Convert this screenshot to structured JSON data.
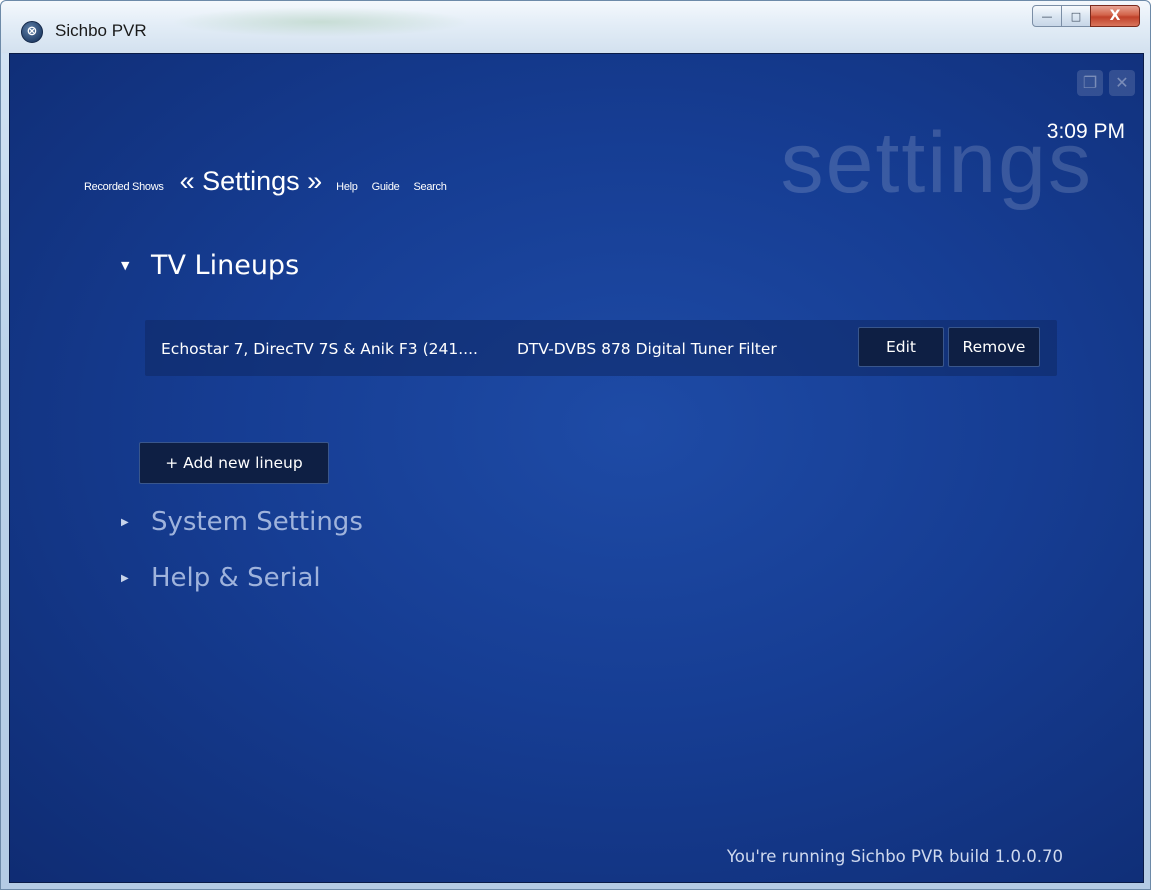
{
  "window": {
    "title": "Sichbo PVR",
    "app_icon_glyph": "⊗",
    "controls": {
      "minimize": "—",
      "maximize": "□",
      "close": "X"
    }
  },
  "header": {
    "background_word": "settings",
    "clock": "3:09 PM",
    "mini_icons": [
      "restore-icon",
      "close-icon"
    ]
  },
  "nav": {
    "recorded_shows": "Recorded Shows",
    "current": "« Settings »",
    "help": "Help",
    "guide": "Guide",
    "search": "Search"
  },
  "sections": {
    "tv_lineups": {
      "caret": "▼",
      "title": "TV Lineups"
    },
    "system_settings": {
      "caret": "▶",
      "title": "System Settings"
    },
    "help_serial": {
      "caret": "▶",
      "title": "Help & Serial"
    }
  },
  "lineup": {
    "name": "Echostar 7, DirecTV 7S & Anik F3 (241....",
    "tuner": "DTV-DVBS 878 Digital Tuner Filter",
    "edit_label": "Edit",
    "remove_label": "Remove"
  },
  "add_lineup_label": "+ Add new lineup",
  "footer": "You're running Sichbo PVR build 1.0.0.70",
  "colors": {
    "background": "#163d93",
    "button_bg": "#0e1f44",
    "text": "#ffffff",
    "dim_text": "#9fb3dc"
  }
}
